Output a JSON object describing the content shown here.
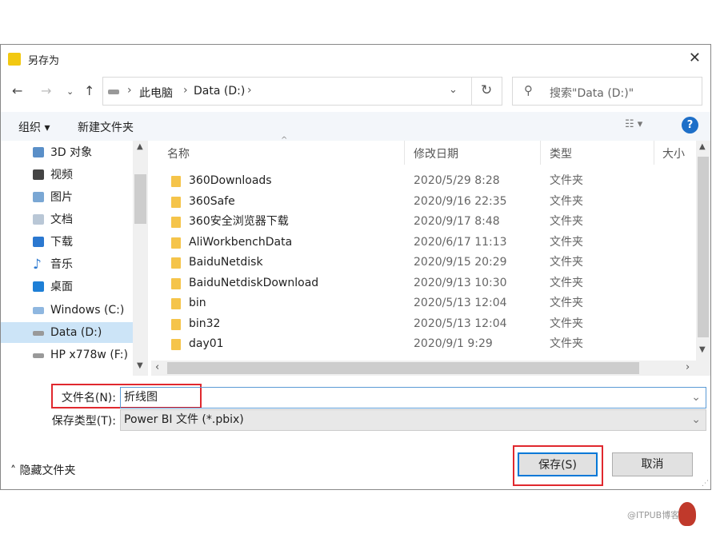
{
  "title": "另存为",
  "address": {
    "crumbs": [
      "此电脑",
      "Data (D:)"
    ],
    "search_placeholder": "搜索\"Data (D:)\""
  },
  "toolbar": {
    "organize": "组织 ▾",
    "new_folder": "新建文件夹"
  },
  "sidebar": [
    {
      "label": "3D 对象"
    },
    {
      "label": "视频"
    },
    {
      "label": "图片"
    },
    {
      "label": "文档"
    },
    {
      "label": "下载"
    },
    {
      "label": "音乐"
    },
    {
      "label": "桌面"
    },
    {
      "label": "Windows (C:)"
    },
    {
      "label": "Data (D:)",
      "selected": true
    },
    {
      "label": "HP x778w (F:)"
    }
  ],
  "columns": [
    "名称",
    "修改日期",
    "类型",
    "大小"
  ],
  "files": [
    {
      "name": "360Downloads",
      "date": "2020/5/29 8:28",
      "type": "文件夹"
    },
    {
      "name": "360Safe",
      "date": "2020/9/16 22:35",
      "type": "文件夹"
    },
    {
      "name": "360安全浏览器下载",
      "date": "2020/9/17 8:48",
      "type": "文件夹"
    },
    {
      "name": "AliWorkbenchData",
      "date": "2020/6/17 11:13",
      "type": "文件夹"
    },
    {
      "name": "BaiduNetdisk",
      "date": "2020/9/15 20:29",
      "type": "文件夹"
    },
    {
      "name": "BaiduNetdiskDownload",
      "date": "2020/9/13 10:30",
      "type": "文件夹"
    },
    {
      "name": "bin",
      "date": "2020/5/13 12:04",
      "type": "文件夹"
    },
    {
      "name": "bin32",
      "date": "2020/5/13 12:04",
      "type": "文件夹"
    },
    {
      "name": "day01",
      "date": "2020/9/1 9:29",
      "type": "文件夹"
    }
  ],
  "form": {
    "filename_label": "文件名(N):",
    "filename_value": "折线图",
    "type_label": "保存类型(T):",
    "type_value": "Power BI 文件 (*.pbix)"
  },
  "footer": {
    "hide_folders": "隐藏文件夹",
    "save": "保存(S)",
    "cancel": "取消"
  },
  "watermark": "@ITPUB博客"
}
